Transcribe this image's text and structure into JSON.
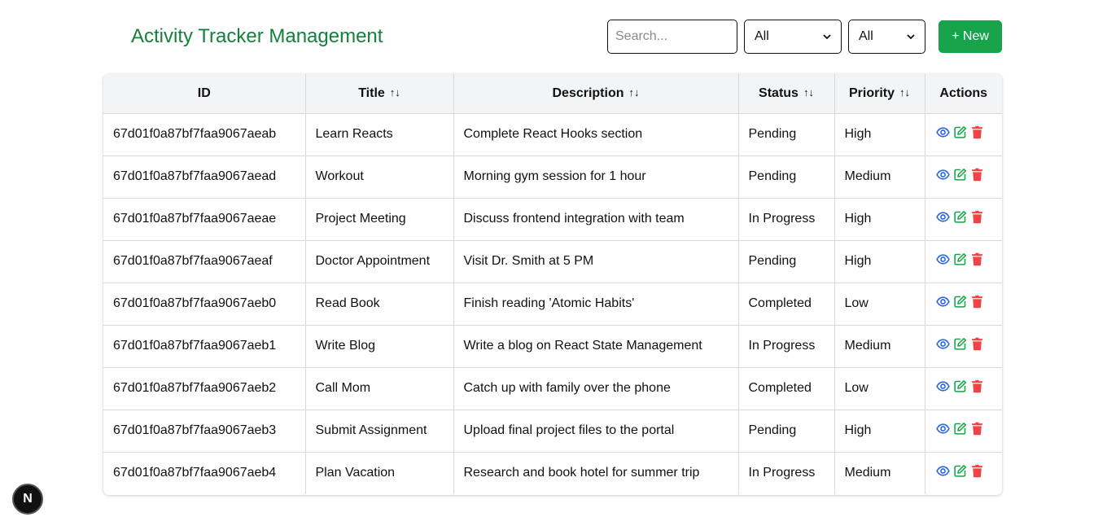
{
  "header": {
    "title": "Activity Tracker Management",
    "search_placeholder": "Search...",
    "status_filter": "All",
    "priority_filter": "All",
    "new_button_label": "+ New"
  },
  "table": {
    "columns": [
      {
        "label": "ID",
        "sortable": false
      },
      {
        "label": "Title",
        "sortable": true
      },
      {
        "label": "Description",
        "sortable": true
      },
      {
        "label": "Status",
        "sortable": true
      },
      {
        "label": "Priority",
        "sortable": true
      },
      {
        "label": "Actions",
        "sortable": false
      }
    ],
    "sort_glyph": "↑↓",
    "rows": [
      {
        "id": "67d01f0a87bf7faa9067aeab",
        "title": "Learn Reacts",
        "description": "Complete React Hooks section",
        "status": "Pending",
        "priority": "High"
      },
      {
        "id": "67d01f0a87bf7faa9067aead",
        "title": "Workout",
        "description": "Morning gym session for 1 hour",
        "status": "Pending",
        "priority": "Medium"
      },
      {
        "id": "67d01f0a87bf7faa9067aeae",
        "title": "Project Meeting",
        "description": "Discuss frontend integration with team",
        "status": "In Progress",
        "priority": "High"
      },
      {
        "id": "67d01f0a87bf7faa9067aeaf",
        "title": "Doctor Appointment",
        "description": "Visit Dr. Smith at 5 PM",
        "status": "Pending",
        "priority": "High"
      },
      {
        "id": "67d01f0a87bf7faa9067aeb0",
        "title": "Read Book",
        "description": "Finish reading 'Atomic Habits'",
        "status": "Completed",
        "priority": "Low"
      },
      {
        "id": "67d01f0a87bf7faa9067aeb1",
        "title": "Write Blog",
        "description": "Write a blog on React State Management",
        "status": "In Progress",
        "priority": "Medium"
      },
      {
        "id": "67d01f0a87bf7faa9067aeb2",
        "title": "Call Mom",
        "description": "Catch up with family over the phone",
        "status": "Completed",
        "priority": "Low"
      },
      {
        "id": "67d01f0a87bf7faa9067aeb3",
        "title": "Submit Assignment",
        "description": "Upload final project files to the portal",
        "status": "Pending",
        "priority": "High"
      },
      {
        "id": "67d01f0a87bf7faa9067aeb4",
        "title": "Plan Vacation",
        "description": "Research and book hotel for summer trip",
        "status": "In Progress",
        "priority": "Medium"
      }
    ]
  },
  "row_actions": [
    "eye-icon",
    "edit-icon",
    "trash-icon"
  ],
  "dev_badge": {
    "label": "N",
    "icon": "nextjs-logo-icon"
  },
  "colors": {
    "title": "#15803d",
    "new_button_bg": "#16a34a",
    "view_icon": "#2563eb",
    "edit_icon": "#16a34a",
    "delete_icon": "#ef4444",
    "header_bg": "#f3f4f6"
  }
}
